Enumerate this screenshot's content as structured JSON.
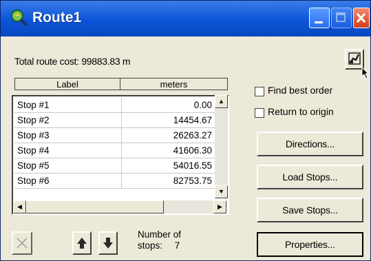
{
  "window": {
    "title": "Route1"
  },
  "summary": {
    "total_cost": "Total route cost: 99883.83 m"
  },
  "table": {
    "columns": [
      "Label",
      "meters"
    ],
    "rows": [
      {
        "label": "Stop #1",
        "value": "0.00"
      },
      {
        "label": "Stop #2",
        "value": "14454.67"
      },
      {
        "label": "Stop #3",
        "value": "26263.27"
      },
      {
        "label": "Stop #4",
        "value": "41606.30"
      },
      {
        "label": "Stop #5",
        "value": "54016.55"
      },
      {
        "label": "Stop #6",
        "value": "82753.75"
      }
    ]
  },
  "options": {
    "find_best_order": "Find best order",
    "return_to_origin": "Return to origin"
  },
  "buttons": {
    "directions": "Directions...",
    "load_stops": "Load Stops...",
    "save_stops": "Save Stops...",
    "properties": "Properties..."
  },
  "stops": {
    "label_line1": "Number of",
    "label_line2": "stops:",
    "count": "7"
  },
  "icons": {
    "app": "route-map-icon",
    "zoom": "zoom-to-route-icon",
    "delete": "delete-x-icon",
    "up": "arrow-up-icon",
    "down": "arrow-down-icon"
  },
  "colors": {
    "titlebar": "#0a54d8",
    "face": "#ece9d8",
    "close": "#d43f1a"
  }
}
